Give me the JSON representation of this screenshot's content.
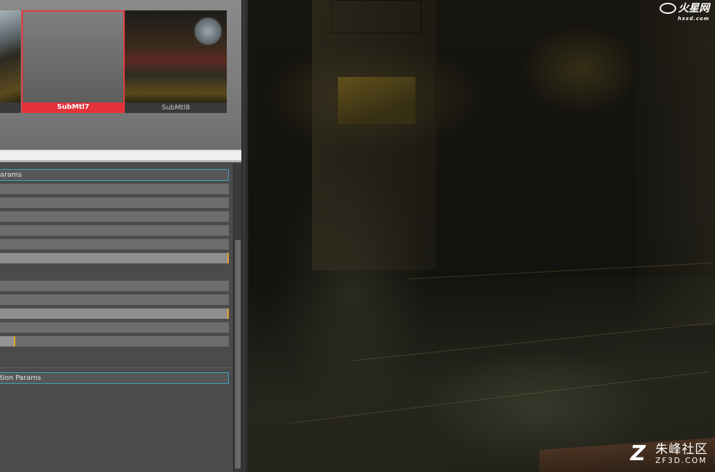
{
  "thumbnails": [
    {
      "caption": "",
      "selected": false
    },
    {
      "caption": "SubMtl7",
      "selected": true
    },
    {
      "caption": "SubMtl8",
      "selected": false
    }
  ],
  "rollouts": [
    {
      "title": "arams"
    },
    {
      "title": "tion Params"
    }
  ],
  "colors": {
    "selection_red": "#e3323a",
    "rollout_border": "#3ea3c6",
    "slider_accent": "#e8a227"
  },
  "watermarks": {
    "top_brand": "火星网",
    "top_domain": "hxsd.com",
    "bottom_brand": "朱峰社区",
    "bottom_domain": "ZF3D.COM"
  }
}
